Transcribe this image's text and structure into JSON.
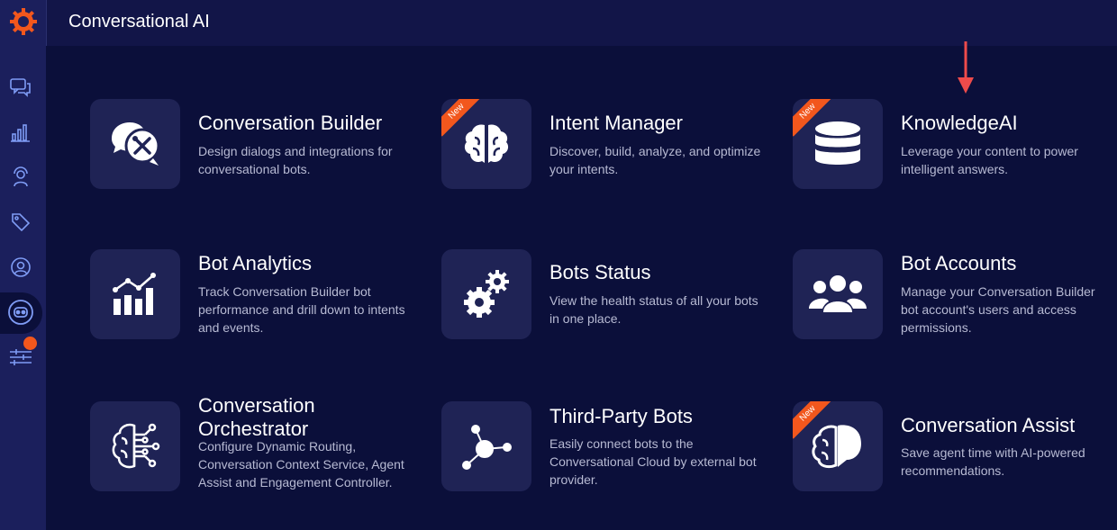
{
  "app": {
    "title": "Conversational AI"
  },
  "colors": {
    "accent": "#f2571d",
    "sidebar": "#1b1f5c",
    "background": "#0b0f3a",
    "tile": "#1f2355"
  },
  "sidebar": {
    "items": [
      {
        "icon": "chat-bubbles-icon"
      },
      {
        "icon": "bar-chart-icon"
      },
      {
        "icon": "agent-icon"
      },
      {
        "icon": "tag-icon"
      },
      {
        "icon": "user-circle-icon"
      },
      {
        "icon": "bot-icon",
        "active": true
      },
      {
        "icon": "sliders-icon"
      }
    ]
  },
  "tiles": [
    {
      "title": "Conversation Builder",
      "description": "Design dialogs and integrations for conversational bots.",
      "icon": "chat-tools-icon"
    },
    {
      "title": "Intent Manager",
      "description": "Discover, build, analyze, and optimize your intents.",
      "icon": "brain-icon",
      "badge": "New"
    },
    {
      "title": "KnowledgeAI",
      "description": "Leverage your content to power intelligent answers.",
      "icon": "database-icon",
      "badge": "New"
    },
    {
      "title": "Bot Analytics",
      "description": "Track Conversation Builder bot performance and drill down to intents and events.",
      "icon": "analytics-icon"
    },
    {
      "title": "Bots Status",
      "description": "View the health status of all your bots in one place.",
      "icon": "gears-icon"
    },
    {
      "title": "Bot Accounts",
      "description": "Manage your Conversation Builder bot account's users and access permissions.",
      "icon": "users-icon"
    },
    {
      "title": "Conversation Orchestrator",
      "description": "Configure Dynamic Routing, Conversation Context Service, Agent Assist and Engagement Controller.",
      "icon": "circuit-brain-icon"
    },
    {
      "title": "Third-Party Bots",
      "description": "Easily connect bots to the Conversational Cloud by external bot provider.",
      "icon": "network-icon"
    },
    {
      "title": "Conversation Assist",
      "description": "Save agent time with AI-powered recommendations.",
      "icon": "brain-chat-icon",
      "badge": "New"
    }
  ]
}
